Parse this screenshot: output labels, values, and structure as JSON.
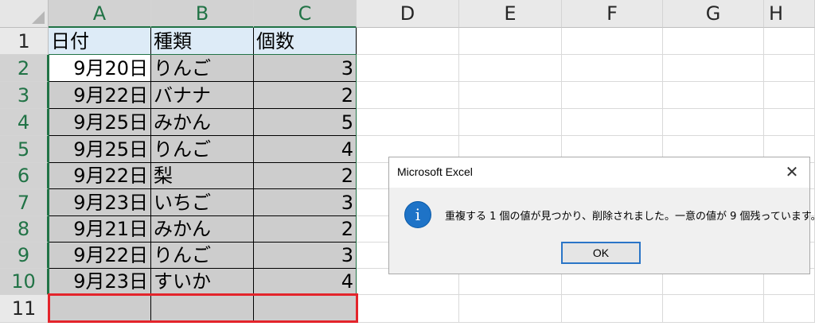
{
  "columns": [
    "A",
    "B",
    "C",
    "D",
    "E",
    "F",
    "G",
    "H"
  ],
  "rows": [
    "1",
    "2",
    "3",
    "4",
    "5",
    "6",
    "7",
    "8",
    "9",
    "10",
    "11"
  ],
  "table": {
    "headers": [
      "日付",
      "種類",
      "個数"
    ],
    "data": [
      [
        "9月20日",
        "りんご",
        "3"
      ],
      [
        "9月22日",
        "バナナ",
        "2"
      ],
      [
        "9月25日",
        "みかん",
        "5"
      ],
      [
        "9月25日",
        "りんご",
        "4"
      ],
      [
        "9月22日",
        "梨",
        "2"
      ],
      [
        "9月23日",
        "いちご",
        "3"
      ],
      [
        "9月21日",
        "みかん",
        "2"
      ],
      [
        "9月22日",
        "りんご",
        "3"
      ],
      [
        "9月23日",
        "すいか",
        "4"
      ]
    ]
  },
  "dialog": {
    "title": "Microsoft Excel",
    "close_glyph": "✕",
    "icon": "info-icon",
    "icon_glyph": "i",
    "message": "重複する 1 個の値が見つかり、削除されました。一意の値が 9 個残っています。",
    "ok_label": "OK"
  },
  "colors": {
    "selection_border": "#217346",
    "header_fill": "#ddebf7",
    "selected_fill": "#cdcdcd",
    "highlight_box": "#e3242b",
    "info_icon": "#1e73c7"
  }
}
